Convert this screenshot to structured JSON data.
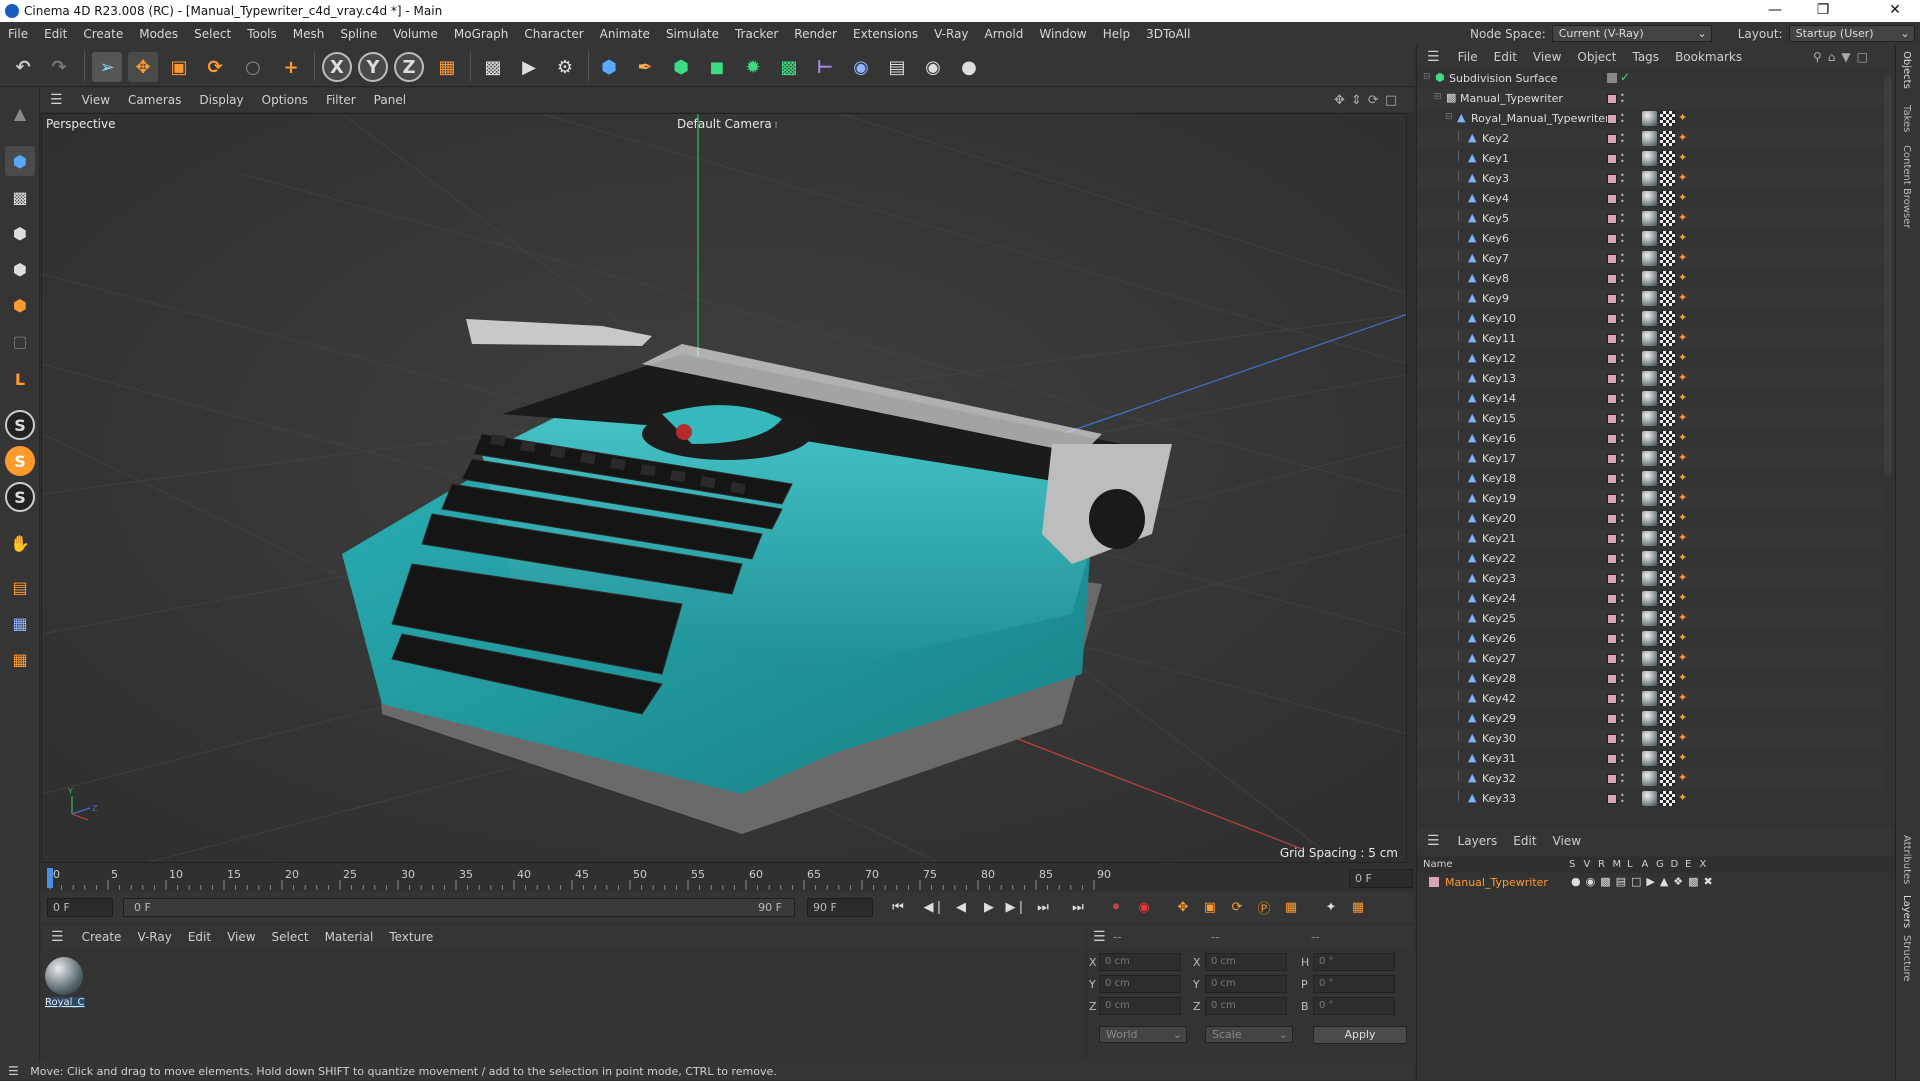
{
  "window": {
    "title": "Cinema 4D R23.008 (RC) - [Manual_Typewriter_c4d_vray.c4d *] - Main"
  },
  "menu": [
    "File",
    "Edit",
    "Create",
    "Modes",
    "Select",
    "Tools",
    "Mesh",
    "Spline",
    "Volume",
    "MoGraph",
    "Character",
    "Animate",
    "Simulate",
    "Tracker",
    "Render",
    "Extensions",
    "V-Ray",
    "Arnold",
    "Window",
    "Help",
    "3DToAll"
  ],
  "nodespace": {
    "label": "Node Space:",
    "value": "Current (V-Ray)"
  },
  "layout": {
    "label": "Layout:",
    "value": "Startup (User)"
  },
  "viewport": {
    "menu": [
      "View",
      "Cameras",
      "Display",
      "Options",
      "Filter",
      "Panel"
    ],
    "label": "Perspective",
    "camera": "Default Camera",
    "grid_spacing": "Grid Spacing : 5 cm"
  },
  "timeline": {
    "ticks": [
      "0",
      "5",
      "10",
      "15",
      "20",
      "25",
      "30",
      "35",
      "40",
      "45",
      "50",
      "55",
      "60",
      "65",
      "70",
      "75",
      "80",
      "85",
      "90"
    ],
    "current_frame": "0 F"
  },
  "playbar": {
    "start": "0 F",
    "range_start": "0 F",
    "range_end": "90 F",
    "end": "90 F"
  },
  "material_manager": {
    "menu": [
      "Create",
      "V-Ray",
      "Edit",
      "View",
      "Select",
      "Material",
      "Texture"
    ],
    "materials": [
      {
        "name": "Royal_C"
      }
    ]
  },
  "coords": {
    "headers": [
      "--",
      "--",
      "--"
    ],
    "rows": [
      {
        "a": "X",
        "av": "0 cm",
        "b": "X",
        "bv": "0 cm",
        "c": "H",
        "cv": "0 °"
      },
      {
        "a": "Y",
        "av": "0 cm",
        "b": "Y",
        "bv": "0 cm",
        "c": "P",
        "cv": "0 °"
      },
      {
        "a": "Z",
        "av": "0 cm",
        "b": "Z",
        "bv": "0 cm",
        "c": "B",
        "cv": "0 °"
      }
    ],
    "world": "World",
    "scale": "Scale",
    "apply": "Apply"
  },
  "status": "Move: Click and drag to move elements. Hold down SHIFT to quantize movement / add to the selection in point mode, CTRL to remove.",
  "object_manager": {
    "menu": [
      "File",
      "Edit",
      "View",
      "Object",
      "Tags",
      "Bookmarks"
    ],
    "objects": [
      {
        "name": "Subdivision Surface",
        "level": 0
      },
      {
        "name": "Manual_Typewriter",
        "level": 1
      },
      {
        "name": "Royal_Manual_Typewriter",
        "level": 2
      },
      {
        "name": "Key2",
        "level": 3
      },
      {
        "name": "Key1",
        "level": 3
      },
      {
        "name": "Key3",
        "level": 3
      },
      {
        "name": "Key4",
        "level": 3
      },
      {
        "name": "Key5",
        "level": 3
      },
      {
        "name": "Key6",
        "level": 3
      },
      {
        "name": "Key7",
        "level": 3
      },
      {
        "name": "Key8",
        "level": 3
      },
      {
        "name": "Key9",
        "level": 3
      },
      {
        "name": "Key10",
        "level": 3
      },
      {
        "name": "Key11",
        "level": 3
      },
      {
        "name": "Key12",
        "level": 3
      },
      {
        "name": "Key13",
        "level": 3
      },
      {
        "name": "Key14",
        "level": 3
      },
      {
        "name": "Key15",
        "level": 3
      },
      {
        "name": "Key16",
        "level": 3
      },
      {
        "name": "Key17",
        "level": 3
      },
      {
        "name": "Key18",
        "level": 3
      },
      {
        "name": "Key19",
        "level": 3
      },
      {
        "name": "Key20",
        "level": 3
      },
      {
        "name": "Key21",
        "level": 3
      },
      {
        "name": "Key22",
        "level": 3
      },
      {
        "name": "Key23",
        "level": 3
      },
      {
        "name": "Key24",
        "level": 3
      },
      {
        "name": "Key25",
        "level": 3
      },
      {
        "name": "Key26",
        "level": 3
      },
      {
        "name": "Key27",
        "level": 3
      },
      {
        "name": "Key28",
        "level": 3
      },
      {
        "name": "Key42",
        "level": 3
      },
      {
        "name": "Key29",
        "level": 3
      },
      {
        "name": "Key30",
        "level": 3
      },
      {
        "name": "Key31",
        "level": 3
      },
      {
        "name": "Key32",
        "level": 3
      },
      {
        "name": "Key33",
        "level": 3
      }
    ]
  },
  "layer_manager": {
    "menu": [
      "Layers",
      "Edit",
      "View"
    ],
    "columns": [
      "Name",
      "S",
      "V",
      "R",
      "M",
      "L",
      "A",
      "G",
      "D",
      "E",
      "X"
    ],
    "layers": [
      {
        "name": "Manual_Typewriter"
      }
    ]
  },
  "right_tabs": [
    "Objects",
    "Takes",
    "Content Browser",
    "Attributes",
    "Layers",
    "Structure"
  ]
}
